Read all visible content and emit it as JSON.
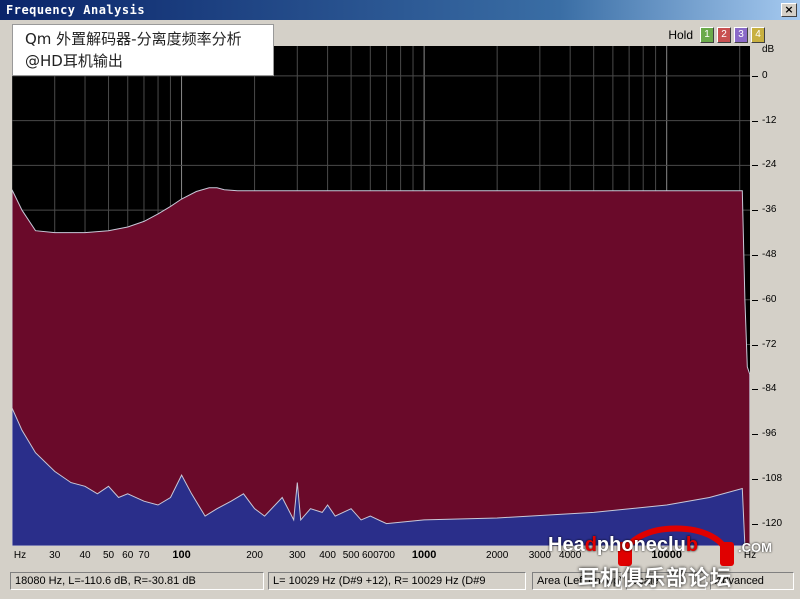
{
  "window": {
    "title": "Frequency Analysis",
    "close_glyph": "×"
  },
  "note": {
    "line1": "Qm 外置解码器-分离度频率分析",
    "line2": "@HD耳机输出"
  },
  "hold": {
    "label": "Hold",
    "buttons": [
      {
        "label": "1",
        "color": "#6aaa4a"
      },
      {
        "label": "2",
        "color": "#c85050"
      },
      {
        "label": "3",
        "color": "#8a6ac8"
      },
      {
        "label": "4",
        "color": "#c8b040"
      }
    ]
  },
  "y_axis": {
    "unit": "dB",
    "ticks": [
      "0",
      "-12",
      "-24",
      "-36",
      "-48",
      "-60",
      "-72",
      "-84",
      "-96",
      "-108",
      "-120"
    ]
  },
  "x_axis": {
    "unit": "Hz",
    "ticks": [
      {
        "label": "30",
        "f": 30,
        "major": false
      },
      {
        "label": "40",
        "f": 40,
        "major": false
      },
      {
        "label": "50",
        "f": 50,
        "major": false
      },
      {
        "label": "60",
        "f": 60,
        "major": false
      },
      {
        "label": "70",
        "f": 70,
        "major": false
      },
      {
        "label": "100",
        "f": 100,
        "major": true
      },
      {
        "label": "200",
        "f": 200,
        "major": false
      },
      {
        "label": "300",
        "f": 300,
        "major": false
      },
      {
        "label": "400",
        "f": 400,
        "major": false
      },
      {
        "label": "500",
        "f": 500,
        "major": false
      },
      {
        "label": "600",
        "f": 600,
        "major": false
      },
      {
        "label": "700",
        "f": 700,
        "major": false
      },
      {
        "label": "1000",
        "f": 1000,
        "major": true
      },
      {
        "label": "2000",
        "f": 2000,
        "major": false
      },
      {
        "label": "3000",
        "f": 3000,
        "major": false
      },
      {
        "label": "4000",
        "f": 4000,
        "major": false
      },
      {
        "label": "10000",
        "f": 10000,
        "major": true
      }
    ]
  },
  "status": {
    "cursor": "18080 Hz, L=-110.6 dB, R=-30.81 dB",
    "peak": "L=  10029 Hz (D#9 +12), R=  10029 Hz (D#9",
    "mode": "Area (Left on top)",
    "scale": "Scale",
    "advanced": "Advanced"
  },
  "logo": {
    "text": "HeadphoneclubCOM",
    "text_a": "Hea",
    "text_b": "phoneclu",
    "com": ".COM",
    "cn": "耳机俱乐部论坛"
  },
  "colors": {
    "plot_bg": "#000000",
    "grid": "#4a4a4a",
    "left_fill": "#6a0a2a",
    "right_fill": "#2a2e8a",
    "outline": "#c8c8d8",
    "logo_red": "#e00000"
  },
  "chart_data": {
    "type": "area",
    "x_scale": "log",
    "xlim": [
      20,
      22050
    ],
    "ylim": [
      -126,
      8
    ],
    "ylabel": "dB",
    "xlabel": "Hz",
    "series": [
      {
        "name": "L",
        "x": [
          20,
          22,
          25,
          30,
          40,
          50,
          60,
          70,
          80,
          90,
          100,
          115,
          130,
          140,
          150,
          170,
          200,
          500,
          1000,
          5000,
          10000,
          17000,
          20500,
          21000,
          21500,
          22000
        ],
        "y": [
          -30.5,
          -36,
          -41.5,
          -42,
          -42,
          -41.5,
          -40.5,
          -39,
          -37,
          -35,
          -33,
          -31,
          -30,
          -30,
          -30.5,
          -30.8,
          -30.8,
          -30.8,
          -30.8,
          -30.8,
          -30.8,
          -30.8,
          -30.8,
          -60,
          -78,
          -80
        ]
      },
      {
        "name": "R",
        "x": [
          20,
          22,
          25,
          30,
          35,
          40,
          45,
          50,
          55,
          60,
          70,
          80,
          90,
          100,
          110,
          125,
          140,
          160,
          180,
          200,
          220,
          260,
          290,
          300,
          310,
          340,
          380,
          400,
          430,
          500,
          550,
          600,
          700,
          1000,
          2000,
          5000,
          10000,
          15000,
          20500,
          21000,
          21500,
          22000
        ],
        "y": [
          -89,
          -95,
          -101,
          -106,
          -109,
          -110,
          -112,
          -110,
          -113,
          -112,
          -114,
          -115,
          -113,
          -107,
          -112,
          -118,
          -116,
          -114,
          -112,
          -116,
          -118,
          -113,
          -119,
          -109,
          -119,
          -116,
          -117,
          -115,
          -118,
          -116,
          -119,
          -118,
          -120,
          -119,
          -118.5,
          -117,
          -115,
          -113,
          -110.6,
          -126,
          -126,
          -126
        ]
      }
    ]
  }
}
